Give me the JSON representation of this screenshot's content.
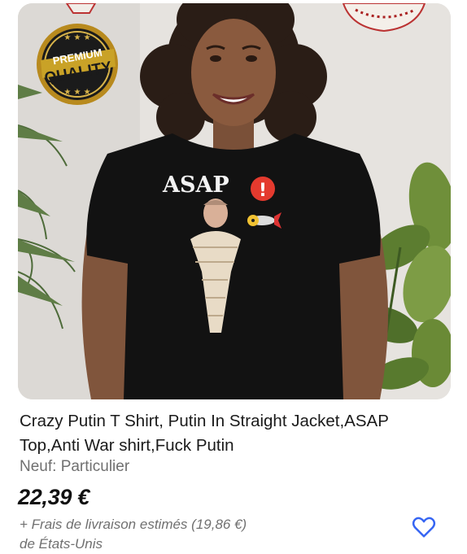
{
  "listing": {
    "title": "Crazy Putin T Shirt, Putin In Straight Jacket,ASAP Top,Anti War shirt,Fuck Putin",
    "condition": "Neuf: Particulier",
    "price": "22,39 €",
    "shipping_line1": "+ Frais de livraison estimés (19,86 €)",
    "shipping_line2": "de États-Unis"
  },
  "image": {
    "badge_line1": "PREMIUM",
    "badge_line2": "QUALITY",
    "shirt_print": "ASAP",
    "exclamation": "!"
  },
  "icons": {
    "watchlist": "heart-outline-icon"
  },
  "colors": {
    "accent": "#3665f3",
    "text_primary": "#111111",
    "text_secondary": "#707070",
    "shirt": "#111111",
    "badge_gold": "#c9a227"
  }
}
